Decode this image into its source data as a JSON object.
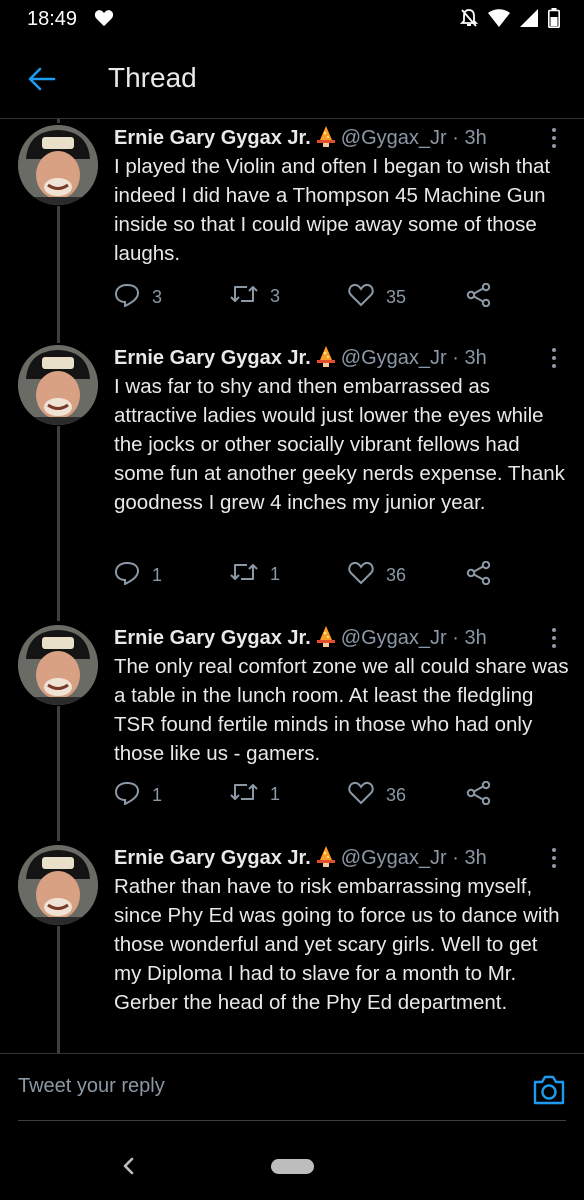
{
  "status": {
    "time": "18:49"
  },
  "header": {
    "title": "Thread"
  },
  "tweets": [
    {
      "name": "Ernie Gary Gygax Jr.",
      "handle": "@Gygax_Jr",
      "separator": "·",
      "time": "3h",
      "text": "I played the Violin and often I began to wish that indeed I did have a Thompson 45 Machine Gun inside so that I could wipe away some of those laughs.",
      "replies": "3",
      "retweets": "3",
      "likes": "35"
    },
    {
      "name": "Ernie Gary Gygax Jr.",
      "handle": "@Gygax_Jr",
      "separator": "·",
      "time": "3h",
      "text": "I was far to shy and then embarrassed as attractive ladies would just lower the eyes while the jocks or other socially vibrant fellows had some fun at another geeky nerds expense. Thank goodness I grew 4 inches my junior year.",
      "replies": "1",
      "retweets": "1",
      "likes": "36"
    },
    {
      "name": "Ernie Gary Gygax Jr.",
      "handle": "@Gygax_Jr",
      "separator": "·",
      "time": "3h",
      "text": "The only real comfort zone we all could share was a table in the lunch room. At least the fledgling TSR found fertile minds in those who had only those like us - gamers.",
      "replies": "1",
      "retweets": "1",
      "likes": "36"
    },
    {
      "name": "Ernie Gary Gygax Jr.",
      "handle": "@Gygax_Jr",
      "separator": "·",
      "time": "3h",
      "text": "Rather than have to risk embarrassing myself, since Phy Ed was going to force us to dance with those wonderful and yet scary girls.  Well to get my Diploma I had to slave for a month to Mr. Gerber the head of the Phy Ed department.",
      "replies": "",
      "retweets": "",
      "likes": ""
    }
  ],
  "reply": {
    "placeholder": "Tweet your reply"
  },
  "colors": {
    "accent": "#1d9bf0",
    "background": "#000000",
    "muted": "#8b98a5"
  }
}
